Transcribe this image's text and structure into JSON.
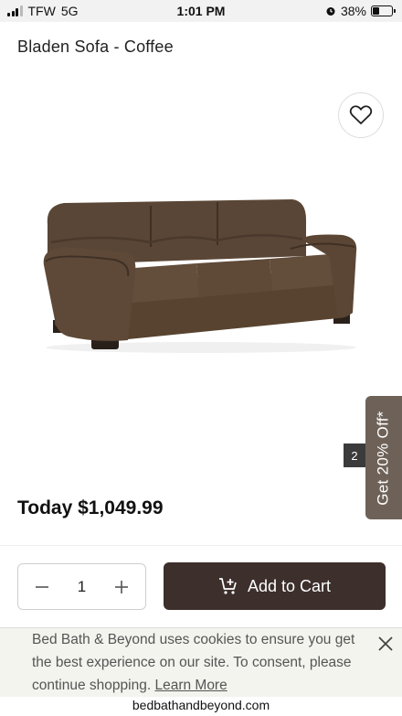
{
  "status_bar": {
    "carrier": "TFW",
    "network": "5G",
    "time": "1:01 PM",
    "battery_percent": "38%",
    "battery_level": 0.38
  },
  "product": {
    "title": "Bladen Sofa - Coffee",
    "price": "Today $1,049.99",
    "image_index": "2",
    "sofa_color": "#5a4636"
  },
  "promo": {
    "label": "Get 20% Off*"
  },
  "cart": {
    "quantity": "1",
    "add_to_cart_label": "Add to Cart"
  },
  "cookie_banner": {
    "text": "Bed Bath & Beyond uses cookies to ensure you get the best experience on our site. To consent, please continue shopping.",
    "learn_more": "Learn More"
  },
  "browser": {
    "url": "bedbathandbeyond.com"
  },
  "icons": [
    "heart-icon",
    "minus-icon",
    "plus-icon",
    "cart-icon",
    "close-icon",
    "alarm-icon"
  ],
  "colors": {
    "primary_button": "#3c2f2c",
    "promo_tab": "#6e6258",
    "cookie_bg": "#f3f4ee"
  }
}
